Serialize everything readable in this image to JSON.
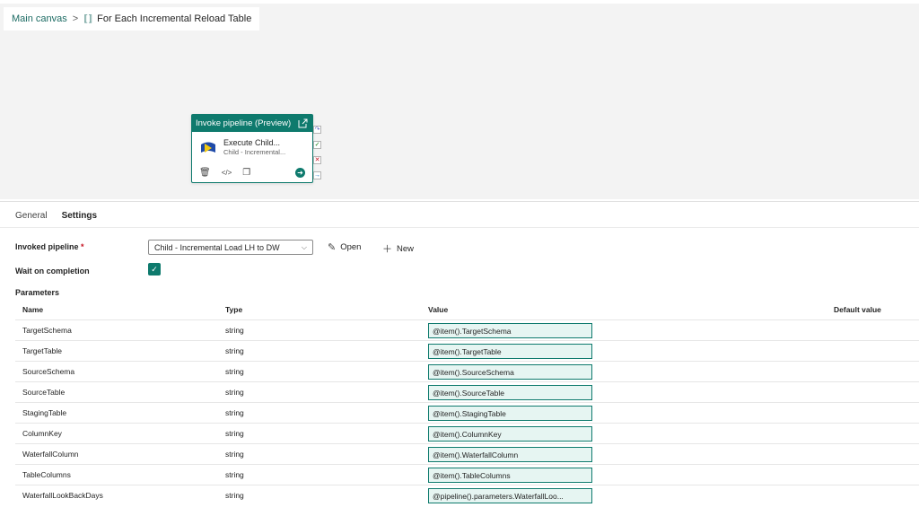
{
  "breadcrumb": {
    "root": "Main canvas",
    "separator": ">",
    "current": "For Each Incremental Reload Table"
  },
  "activity": {
    "header": "Invoke pipeline (Preview)",
    "title": "Execute Child...",
    "subtitle": "Child - Incremental..."
  },
  "tabs": [
    "General",
    "Settings"
  ],
  "settings": {
    "invoked_pipeline_label": "Invoked pipeline",
    "required_mark": "*",
    "invoked_pipeline_value": "Child - Incremental Load LH to DW",
    "open_label": "Open",
    "new_label": "New",
    "wait_label": "Wait on completion",
    "wait_checked": true,
    "parameters_label": "Parameters"
  },
  "table": {
    "headers": {
      "name": "Name",
      "type": "Type",
      "value": "Value",
      "default": "Default value"
    },
    "rows": [
      {
        "name": "TargetSchema",
        "type": "string",
        "value": "@item().TargetSchema"
      },
      {
        "name": "TargetTable",
        "type": "string",
        "value": "@item().TargetTable"
      },
      {
        "name": "SourceSchema",
        "type": "string",
        "value": "@item().SourceSchema"
      },
      {
        "name": "SourceTable",
        "type": "string",
        "value": "@item().SourceTable"
      },
      {
        "name": "StagingTable",
        "type": "string",
        "value": "@item().StagingTable"
      },
      {
        "name": "ColumnKey",
        "type": "string",
        "value": "@item().ColumnKey"
      },
      {
        "name": "WaterfallColumn",
        "type": "string",
        "value": "@item().WaterfallColumn"
      },
      {
        "name": "TableColumns",
        "type": "string",
        "value": "@item().TableColumns"
      },
      {
        "name": "WaterfallLookBackDays",
        "type": "string",
        "value": "@pipeline().parameters.WaterfallLoo..."
      }
    ]
  },
  "colors": {
    "accent": "#0e7a6d",
    "value_bg": "#e6f5f2"
  }
}
